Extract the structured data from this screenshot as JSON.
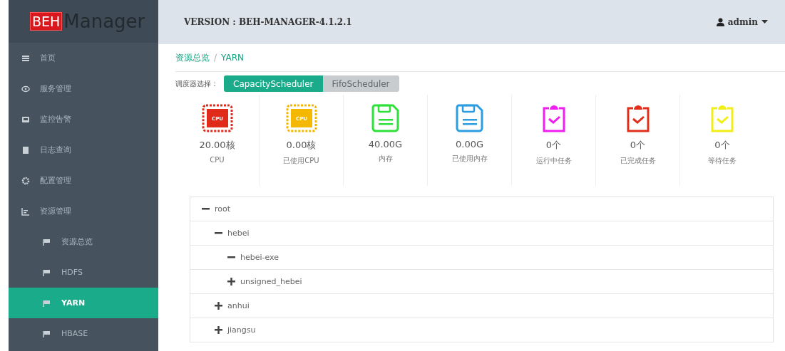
{
  "logo": {
    "badge": "BEH",
    "name": "Manager"
  },
  "header": {
    "version": "VERSION : BEH-MANAGER-4.1.2.1",
    "user": "admin"
  },
  "sidebar": {
    "items": [
      {
        "label": "首页",
        "selected": false
      },
      {
        "label": "服务管理",
        "selected": false
      },
      {
        "label": "监控告警",
        "selected": false
      },
      {
        "label": "日志查询",
        "selected": false
      },
      {
        "label": "配置管理",
        "selected": false
      },
      {
        "label": "资源管理",
        "selected": false,
        "children": [
          {
            "label": "资源总览",
            "selected": false
          },
          {
            "label": "HDFS",
            "selected": false
          },
          {
            "label": "YARN",
            "selected": true
          },
          {
            "label": "HBASE",
            "selected": false
          }
        ]
      }
    ]
  },
  "breadcrumb": {
    "items": [
      "资源总览",
      "YARN"
    ],
    "separator": "/"
  },
  "scheduler": {
    "label": "调度器选择：",
    "options": [
      {
        "label": "CapacityScheduler",
        "selected": true
      },
      {
        "label": "FifoScheduler",
        "selected": false
      }
    ]
  },
  "stats": [
    {
      "kind": "cpu",
      "color": "#e02a1a",
      "chip": "CPU",
      "value": "20.00核",
      "label": "CPU"
    },
    {
      "kind": "cpu",
      "color": "#f5b800",
      "chip": "CPU",
      "value": "0.00核",
      "label": "已使用CPU"
    },
    {
      "kind": "disk",
      "color": "#2fe03a",
      "value": "40.00G",
      "label": "内存"
    },
    {
      "kind": "disk",
      "color": "#2b9de0",
      "value": "0.00G",
      "label": "已使用内存"
    },
    {
      "kind": "task",
      "color": "#f01ef0",
      "value": "0个",
      "label": "运行中任务"
    },
    {
      "kind": "task",
      "color": "#e0301c",
      "value": "0个",
      "label": "已完成任务"
    },
    {
      "kind": "task",
      "color": "#f2ee18",
      "value": "0个",
      "label": "等待任务"
    }
  ],
  "tree": [
    {
      "label": "root",
      "expanded": true,
      "children": [
        {
          "label": "hebei",
          "expanded": true,
          "children": [
            {
              "label": "hebei-exe",
              "expanded": true
            },
            {
              "label": "unsigned_hebei",
              "expanded": false
            }
          ]
        },
        {
          "label": "anhui",
          "expanded": false
        },
        {
          "label": "jiangsu",
          "expanded": false
        }
      ]
    }
  ]
}
